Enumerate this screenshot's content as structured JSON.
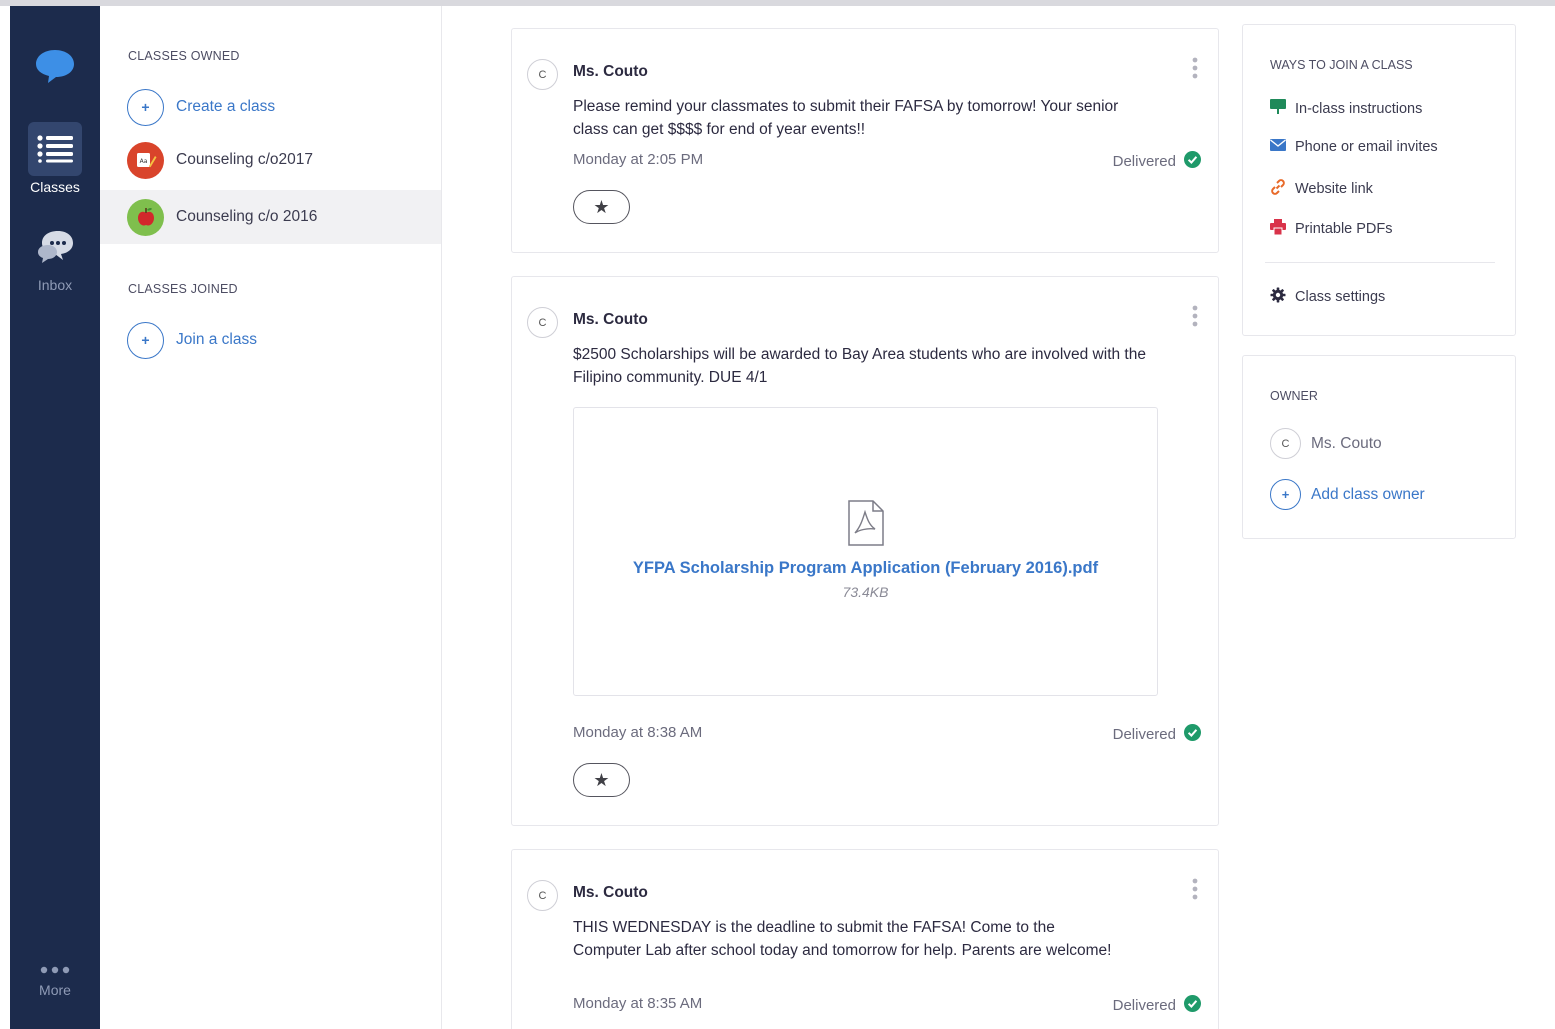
{
  "nav": {
    "classes_label": "Classes",
    "inbox_label": "Inbox",
    "more_label": "More"
  },
  "classes_panel": {
    "owned_header": "CLASSES OWNED",
    "create_label": "Create a class",
    "owned": [
      {
        "name": "Counseling c/o2017",
        "icon": "dictionary-icon",
        "color": "#d9442b"
      },
      {
        "name": "Counseling c/o 2016",
        "icon": "apple-icon",
        "color": "#7fbf4d"
      }
    ],
    "joined_header": "CLASSES JOINED",
    "join_label": "Join a class"
  },
  "feed": [
    {
      "avatar": "C",
      "author": "Ms. Couto",
      "body": "Please remind your classmates to submit their FAFSA by tomorrow! Your senior class can get $$$$ for end of year events!!",
      "time": "Monday at 2:05 PM",
      "status": "Delivered"
    },
    {
      "avatar": "C",
      "author": "Ms. Couto",
      "body": "$2500 Scholarships will be awarded to Bay Area students who are involved with the Filipino community. DUE 4/1",
      "attachment": {
        "name": "YFPA Scholarship Program Application (February 2016).pdf",
        "size": "73.4KB"
      },
      "time": "Monday at 8:38 AM",
      "status": "Delivered"
    },
    {
      "avatar": "C",
      "author": "Ms. Couto",
      "body": "THIS WEDNESDAY is the deadline to submit the FAFSA! Come to the Computer Lab after school today and tomorrow for help. Parents are welcome!",
      "time": "Monday at 8:35 AM",
      "status": "Delivered"
    }
  ],
  "sidebar": {
    "ways_header": "WAYS TO JOIN A CLASS",
    "ways": [
      {
        "label": "In-class instructions",
        "icon": "presentation-icon",
        "color": "#1f8a5a"
      },
      {
        "label": "Phone or email invites",
        "icon": "envelope-icon",
        "color": "#3a77c8"
      },
      {
        "label": "Website link",
        "icon": "link-icon",
        "color": "#e86a2a"
      },
      {
        "label": "Printable PDFs",
        "icon": "printer-icon",
        "color": "#d9334a"
      }
    ],
    "settings_label": "Class settings",
    "owner_header": "OWNER",
    "owner_avatar": "C",
    "owner_name": "Ms. Couto",
    "add_owner_label": "Add class owner"
  },
  "colors": {
    "rail": "#1c2b4c",
    "accent": "#3a77c8",
    "delivered": "#1f9a6a"
  }
}
